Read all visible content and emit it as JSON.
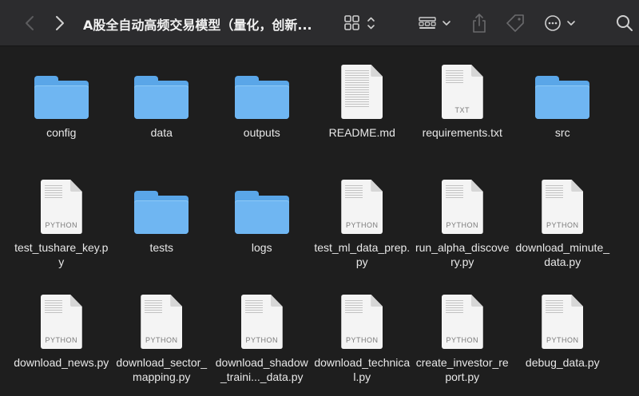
{
  "toolbar": {
    "title": "A股全自动高频交易模型（量化，创新...",
    "back_icon": "chevron-left-icon",
    "forward_icon": "chevron-right-icon",
    "view_icon": "grid-view-icon",
    "group_icon": "group-icon",
    "share_icon": "share-icon",
    "tag_icon": "tag-icon",
    "more_icon": "more-icon",
    "search_icon": "search-icon"
  },
  "items": [
    {
      "name": "config",
      "kind": "folder"
    },
    {
      "name": "data",
      "kind": "folder"
    },
    {
      "name": "outputs",
      "kind": "folder"
    },
    {
      "name": "README.md",
      "kind": "doc",
      "label": ""
    },
    {
      "name": "requirements.txt",
      "kind": "doc",
      "label": "TXT"
    },
    {
      "name": "src",
      "kind": "folder"
    },
    {
      "name": "test_tushare_key.py",
      "kind": "doc",
      "label": "PYTHON"
    },
    {
      "name": "tests",
      "kind": "folder"
    },
    {
      "name": "logs",
      "kind": "folder"
    },
    {
      "name": "test_ml_data_prep.py",
      "kind": "doc",
      "label": "PYTHON"
    },
    {
      "name": "run_alpha_discovery.py",
      "kind": "doc",
      "label": "PYTHON"
    },
    {
      "name": "download_minute_data.py",
      "kind": "doc",
      "label": "PYTHON"
    },
    {
      "name": "download_news.py",
      "kind": "doc",
      "label": "PYTHON"
    },
    {
      "name": "download_sector_mapping.py",
      "kind": "doc",
      "label": "PYTHON"
    },
    {
      "name": "download_shadow_traini..._data.py",
      "kind": "doc",
      "label": "PYTHON"
    },
    {
      "name": "download_technical.py",
      "kind": "doc",
      "label": "PYTHON"
    },
    {
      "name": "create_investor_report.py",
      "kind": "doc",
      "label": "PYTHON"
    },
    {
      "name": "debug_data.py",
      "kind": "doc",
      "label": "PYTHON"
    }
  ]
}
